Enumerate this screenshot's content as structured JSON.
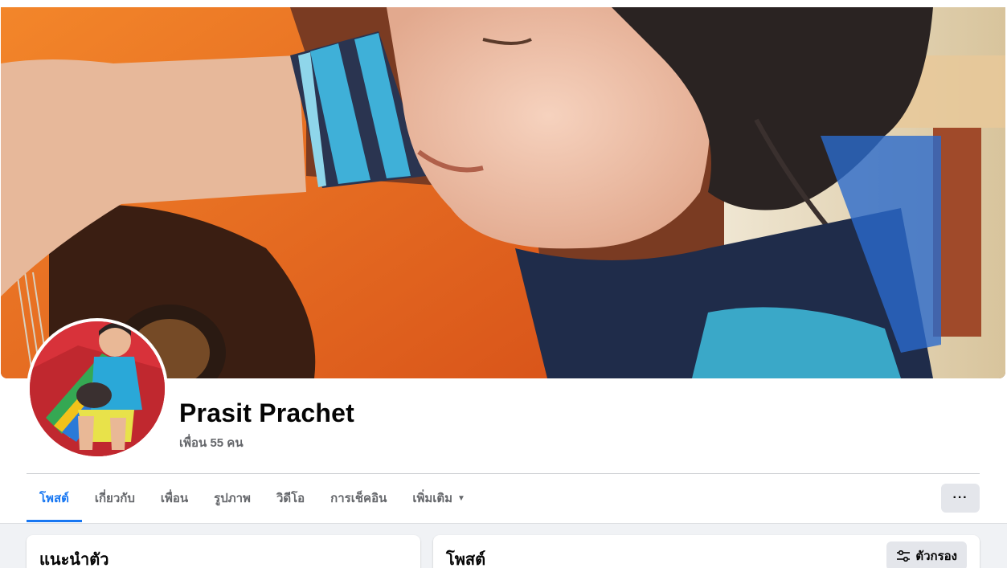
{
  "profile": {
    "name": "Prasit Prachet",
    "friends_text": "เพื่อน 55 คน"
  },
  "tabs": [
    {
      "label": "โพสต์",
      "active": true
    },
    {
      "label": "เกี่ยวกับ",
      "active": false
    },
    {
      "label": "เพื่อน",
      "active": false
    },
    {
      "label": "รูปภาพ",
      "active": false
    },
    {
      "label": "วิดีโอ",
      "active": false
    },
    {
      "label": "การเช็คอิน",
      "active": false
    },
    {
      "label": "เพิ่มเติม",
      "active": false,
      "dropdown": true
    }
  ],
  "more_button": {
    "label": "···"
  },
  "intro_card": {
    "title": "แนะนำตัว"
  },
  "posts_card": {
    "title": "โพสต์",
    "filter_label": "ตัวกรอง"
  },
  "icons": {
    "dropdown": "caret-down-icon",
    "more": "more-horizontal-icon",
    "filter": "filter-icon"
  },
  "colors": {
    "accent": "#1877f2",
    "tab_text": "#65676b",
    "button_bg": "#e4e6eb",
    "page_bg": "#f0f2f5"
  }
}
